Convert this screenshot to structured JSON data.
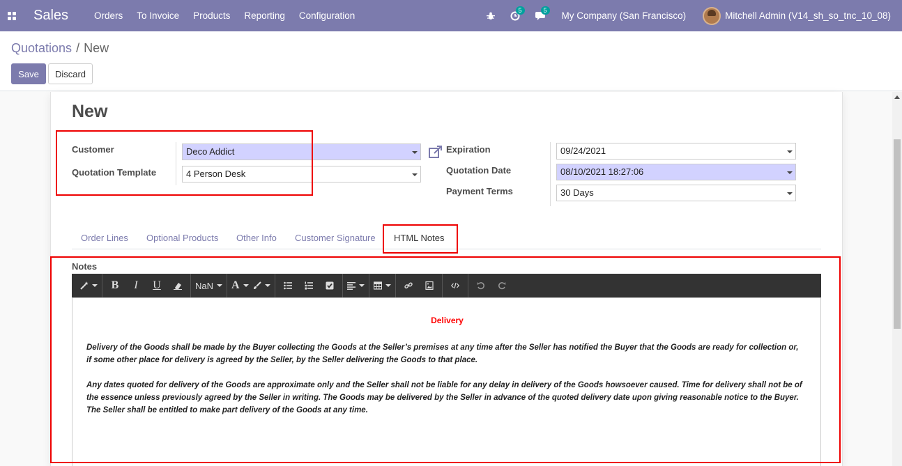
{
  "navbar": {
    "app_name": "Sales",
    "menu": [
      "Orders",
      "To Invoice",
      "Products",
      "Reporting",
      "Configuration"
    ],
    "activity_count": "5",
    "messages_count": "5",
    "company": "My Company (San Francisco)",
    "user": "Mitchell Admin (V14_sh_so_tnc_10_08)"
  },
  "breadcrumb": {
    "parent": "Quotations",
    "separator": "/",
    "current": "New"
  },
  "buttons": {
    "save": "Save",
    "discard": "Discard"
  },
  "form": {
    "title": "New",
    "customer_label": "Customer",
    "customer_value": "Deco Addict",
    "template_label": "Quotation Template",
    "template_value": "4 Person Desk",
    "expiration_label": "Expiration",
    "expiration_value": "09/24/2021",
    "quotation_date_label": "Quotation Date",
    "quotation_date_value": "08/10/2021 18:27:06",
    "payment_terms_label": "Payment Terms",
    "payment_terms_value": "30 Days"
  },
  "tabs": [
    "Order Lines",
    "Optional Products",
    "Other Info",
    "Customer Signature",
    "HTML Notes"
  ],
  "active_tab": "HTML Notes",
  "notes": {
    "label": "Notes",
    "font_size_value": "NaN",
    "heading": "Delivery",
    "paragraph1": "Delivery of the Goods shall be made by the Buyer collecting the Goods at the Seller’s premises at any time after the Seller has notified the Buyer that the Goods are ready for collection or, if some other place for delivery is agreed by the Seller, by the Seller delivering the Goods to that place.",
    "paragraph2": "Any dates quoted for delivery of the Goods are approximate only and the Seller shall not be liable for any delay in delivery of the Goods howsoever caused. Time for delivery shall not be of the essence unless previously agreed by the Seller in writing. The Goods may be delivered by the Seller in advance of the quoted delivery date upon giving reasonable notice to the Buyer. The Seller shall be entitled to make part delivery of the Goods at any time."
  },
  "colors": {
    "brand": "#7c7bad",
    "badge": "#00a09d",
    "highlight": "#ff0000",
    "required_field": "#d2d2ff"
  }
}
